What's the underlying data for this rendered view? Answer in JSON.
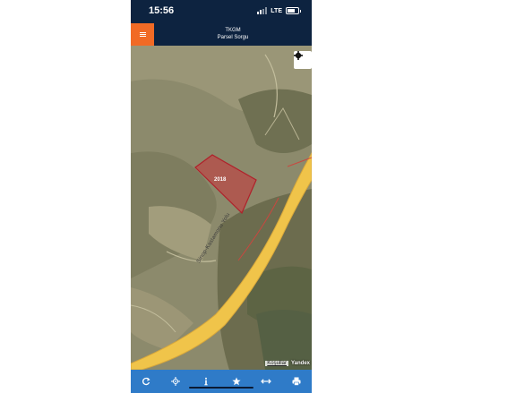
{
  "status_bar": {
    "time": "15:56",
    "network": "LTE"
  },
  "header": {
    "agency": "TKGM",
    "title": "Parsel Sorgu"
  },
  "map": {
    "parcel_label": "2018",
    "road_label": "Sinop-Kastamonu Yolu",
    "attribution_link": "Koşullar",
    "provider": "Yandex"
  },
  "toolbar": {
    "buttons": [
      "refresh-icon",
      "locate-icon",
      "info-icon",
      "favorite-icon",
      "measure-icon",
      "print-icon"
    ]
  },
  "colors": {
    "header_bg": "#0d2340",
    "menu_accent": "#f16a25",
    "toolbar_bg": "#2f7bc8",
    "parcel_fill": "#c8333a",
    "road": "#f0c44a"
  }
}
